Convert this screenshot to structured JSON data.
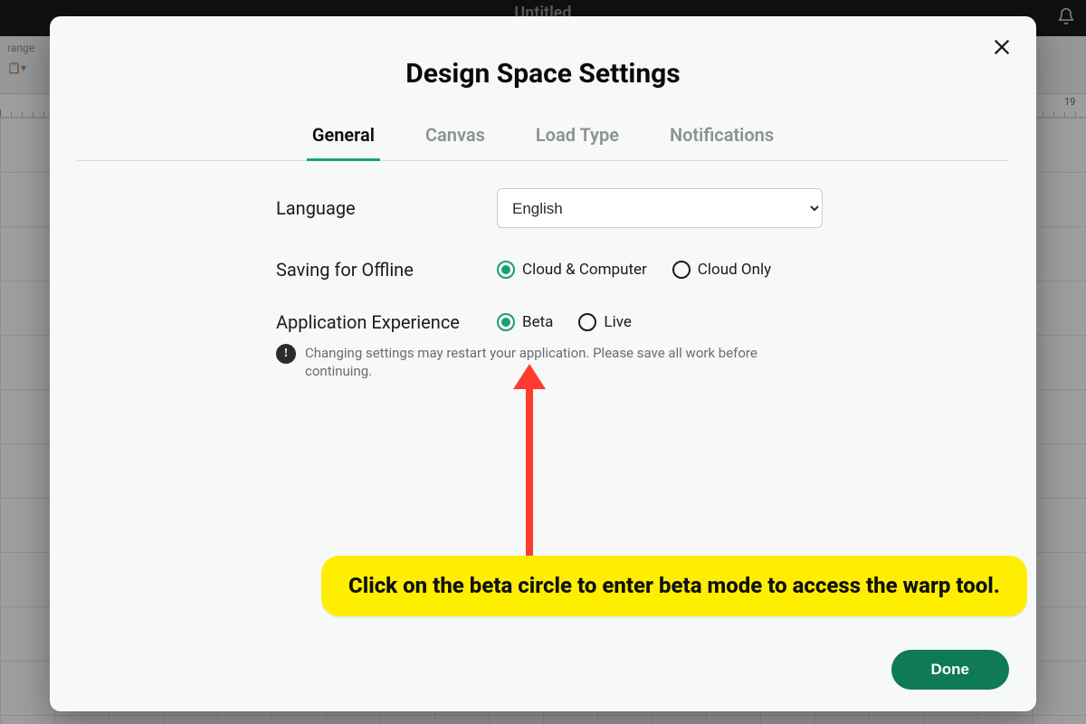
{
  "topbar": {
    "title": "Untitled"
  },
  "toolbar": {
    "label": "range"
  },
  "ruler": {
    "visible_number": "19"
  },
  "modal": {
    "title": "Design Space Settings",
    "tabs": [
      "General",
      "Canvas",
      "Load Type",
      "Notifications"
    ],
    "active_tab_index": 0,
    "language": {
      "label": "Language",
      "value": "English"
    },
    "saving": {
      "label": "Saving for Offline",
      "options": [
        "Cloud & Computer",
        "Cloud Only"
      ],
      "selected_index": 0
    },
    "experience": {
      "label": "Application Experience",
      "options": [
        "Beta",
        "Live"
      ],
      "selected_index": 0
    },
    "warning": "Changing settings may restart your application. Please save all work before continuing.",
    "done_label": "Done"
  },
  "annotation": {
    "text": "Click on the beta circle to enter beta mode to access the warp tool."
  }
}
